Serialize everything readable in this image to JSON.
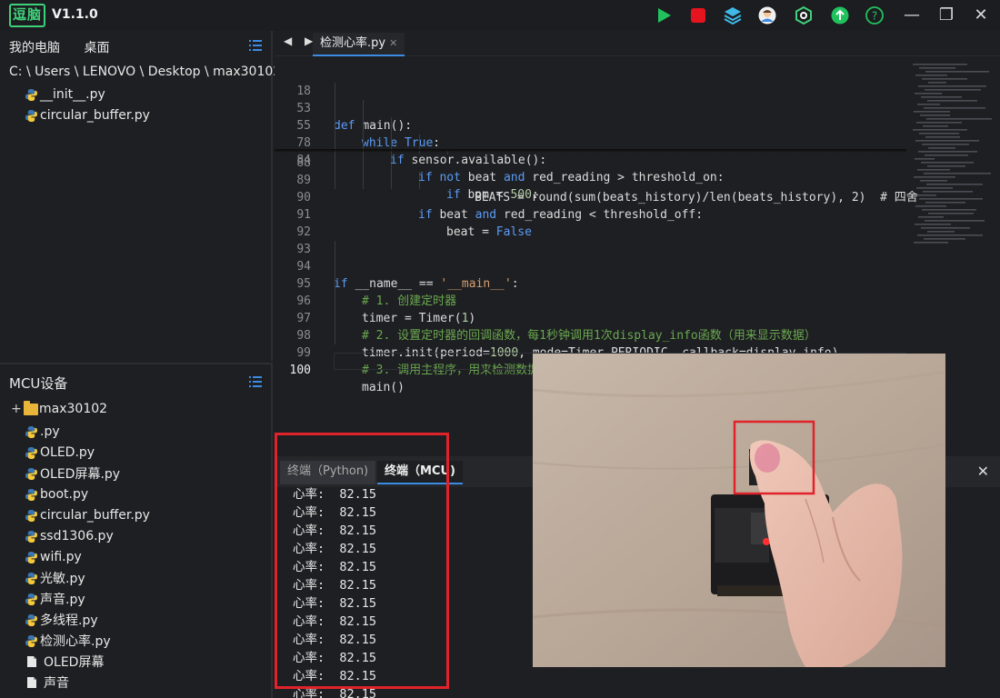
{
  "app": {
    "logo_text": "逗脑",
    "version": "V1.1.0"
  },
  "toolbar": {
    "icons": [
      "run-icon",
      "stop-icon",
      "layers-icon",
      "avatar-icon",
      "settings-icon",
      "upload-icon",
      "help-icon"
    ],
    "colors": {
      "run": "#21c25e",
      "stop": "#e5141f",
      "accent": "#3c8be4"
    }
  },
  "window_controls": {
    "minimize": "—",
    "restore": "❐",
    "close": "✕"
  },
  "file_panel": {
    "tabs": [
      "我的电脑",
      "桌面"
    ],
    "path": "C: \\ Users \\ LENOVO \\ Desktop \\ max30102",
    "files": [
      "__init__.py",
      "circular_buffer.py"
    ]
  },
  "mcu_panel": {
    "title": "MCU设备",
    "folder": "max30102",
    "files": [
      ".py",
      "OLED.py",
      "OLED屏幕.py",
      "boot.py",
      "circular_buffer.py",
      "ssd1306.py",
      "wifi.py",
      "光敏.py",
      "声音.py",
      "多线程.py",
      "检测心率.py"
    ],
    "docs": [
      "OLED屏幕",
      "声音"
    ]
  },
  "editor": {
    "nav": "◀ ▶",
    "tab_label": "检测心率.py",
    "tab_close": "✕",
    "sticky_lines": [
      {
        "ln": "18",
        "indent": 0,
        "parts": [
          [
            "kw",
            "def "
          ],
          [
            "",
            "main():"
          ]
        ]
      },
      {
        "ln": "53",
        "indent": 1,
        "parts": [
          [
            "kw",
            "while "
          ],
          [
            "kw",
            "True"
          ],
          [
            "",
            ":"
          ]
        ]
      },
      {
        "ln": "55",
        "indent": 2,
        "parts": [
          [
            "kw",
            "if "
          ],
          [
            "",
            "sensor.available():"
          ]
        ]
      },
      {
        "ln": "78",
        "indent": 3,
        "parts": [
          [
            "kw",
            "if not "
          ],
          [
            "",
            "beat "
          ],
          [
            "kw",
            "and "
          ],
          [
            "",
            "red_reading > threshold_on:"
          ]
        ]
      },
      {
        "ln": "84",
        "indent": 4,
        "parts": [
          [
            "kw",
            "if "
          ],
          [
            "",
            "bpm < "
          ],
          [
            "num",
            "500"
          ],
          [
            "",
            ":"
          ]
        ]
      }
    ],
    "hidden_line": "BEATS = round(sum(beats_history)/len(beats_history), 2)  # 四舍",
    "lines": [
      {
        "ln": "88",
        "indent": 5,
        "parts": [
          [
            "",
            "BEATS = round(sum(beats_history)/len(beats_history), 2)  # 四舍"
          ]
        ]
      },
      {
        "ln": "89",
        "indent": 3,
        "parts": [
          [
            "kw",
            "if "
          ],
          [
            "",
            "beat "
          ],
          [
            "kw",
            "and "
          ],
          [
            "",
            "red_reading < threshold_off:"
          ]
        ]
      },
      {
        "ln": "90",
        "indent": 4,
        "parts": [
          [
            "",
            "beat = "
          ],
          [
            "kw",
            "False"
          ]
        ]
      },
      {
        "ln": "91",
        "indent": 0,
        "parts": []
      },
      {
        "ln": "92",
        "indent": 0,
        "parts": []
      },
      {
        "ln": "93",
        "indent": 0,
        "parts": [
          [
            "kw",
            "if "
          ],
          [
            "",
            "__name__ == "
          ],
          [
            "str",
            "'__main__'"
          ],
          [
            "",
            ":"
          ]
        ]
      },
      {
        "ln": "94",
        "indent": 1,
        "parts": [
          [
            "cmt",
            "# 1. 创建定时器"
          ]
        ]
      },
      {
        "ln": "95",
        "indent": 1,
        "parts": [
          [
            "",
            "timer = Timer("
          ],
          [
            "num",
            "1"
          ],
          [
            "",
            ")"
          ]
        ]
      },
      {
        "ln": "96",
        "indent": 1,
        "parts": [
          [
            "cmt",
            "# 2. 设置定时器的回调函数，每1秒钟调用1次display_info函数（用来显示数据）"
          ]
        ]
      },
      {
        "ln": "97",
        "indent": 1,
        "parts": [
          [
            "",
            "timer.init(period="
          ],
          [
            "num",
            "1000"
          ],
          [
            "",
            ", mode=Timer.PERIODIC, callback=display_info)"
          ]
        ]
      },
      {
        "ln": "98",
        "indent": 1,
        "parts": [
          [
            "cmt",
            "# 3. 调用主程序，用来检测数据"
          ]
        ]
      },
      {
        "ln": "99",
        "indent": 1,
        "parts": [
          [
            "",
            "main()"
          ]
        ]
      },
      {
        "ln": "100",
        "indent": 0,
        "parts": [],
        "current": true
      }
    ]
  },
  "terminal": {
    "tabs": [
      "终端（Python)",
      "终端（MCU)"
    ],
    "active_tab": 1,
    "close": "✕",
    "label": "心率:",
    "value": "82.15",
    "lines": [
      "心率:  82.15",
      "心率:  82.15",
      "心率:  82.15",
      "心率:  82.15",
      "心率:  82.15",
      "心率:  82.15",
      "心率:  82.15",
      "心率:  82.15",
      "心率:  82.15",
      "心率:  82.15",
      "心率:  82.15",
      "心率:  82.15"
    ]
  }
}
